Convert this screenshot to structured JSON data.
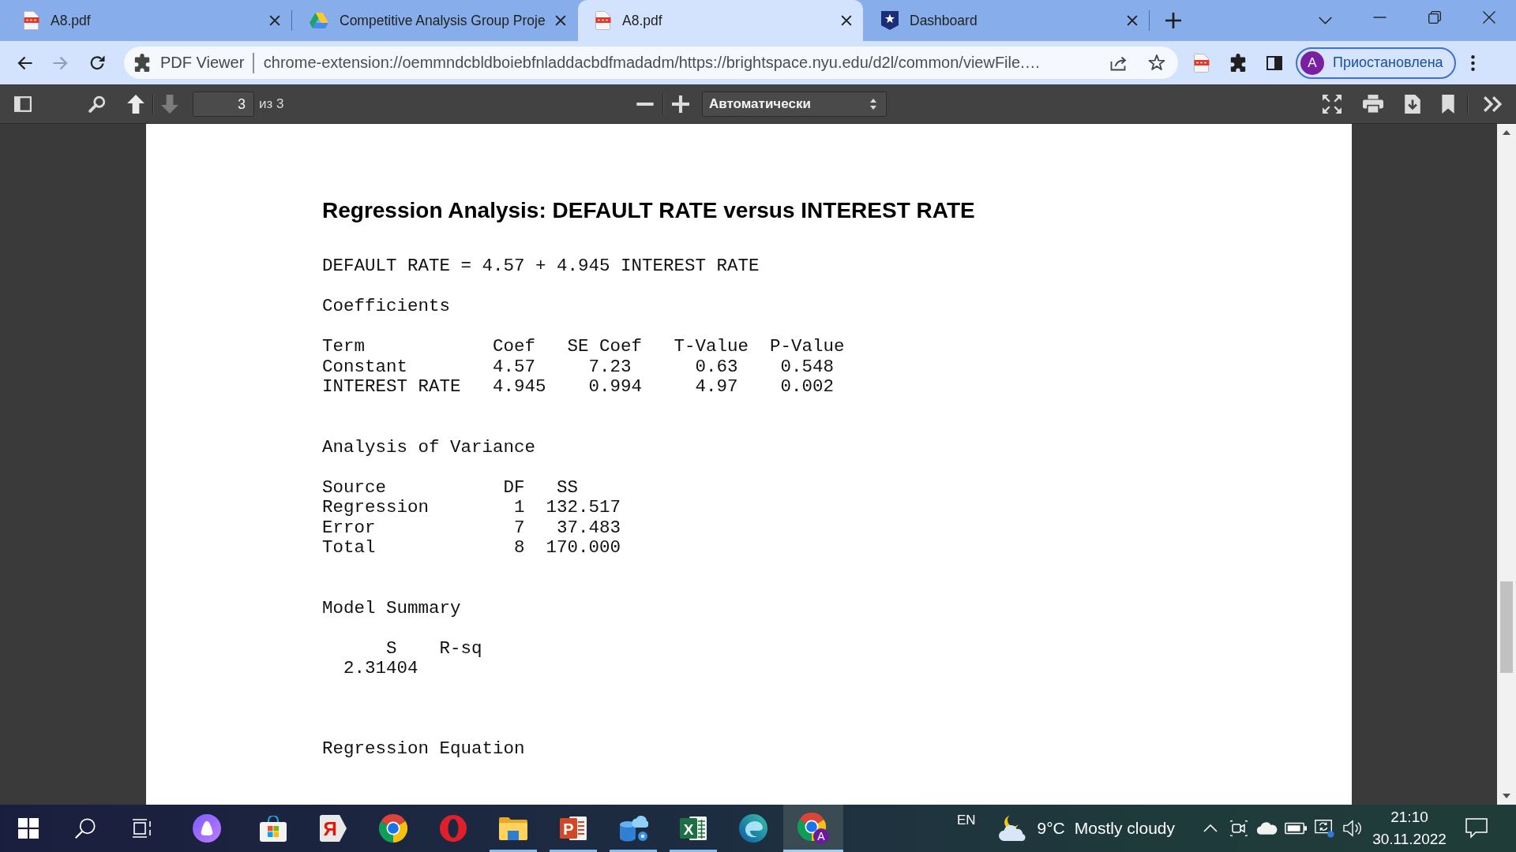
{
  "browser": {
    "tabs": [
      {
        "kind": "pdf",
        "title": "A8.pdf",
        "selected": false
      },
      {
        "kind": "drive",
        "title": "Competitive Analysis Group Proje",
        "selected": false
      },
      {
        "kind": "pdf",
        "title": "A8.pdf",
        "selected": true
      },
      {
        "kind": "dashboard",
        "title": "Dashboard",
        "selected": false
      }
    ],
    "address_bar": {
      "chip": "PDF Viewer",
      "url": "chrome-extension://oemmndcbldboiebfnladdacbdfmadadm/https://brightspace.nyu.edu/d2l/common/viewFile.…"
    },
    "profile": {
      "initial": "A",
      "status": "Приостановлена"
    }
  },
  "pdf_toolbar": {
    "previous": {
      "disabled": false
    },
    "next": {
      "disabled": true
    },
    "page": "3",
    "page_count": "из 3",
    "zoom": "Автоматически"
  },
  "document": {
    "title": "Regression Analysis: DEFAULT RATE versus INTEREST RATE",
    "equation": "DEFAULT RATE = 4.57 + 4.945 INTEREST RATE",
    "sections": [
      {
        "heading": "Coefficients",
        "columns": [
          "Term",
          "Coef",
          "SE Coef",
          "T-Value",
          "P-Value"
        ],
        "rows": [
          [
            "Constant",
            "4.57",
            "7.23",
            "0.63",
            "0.548"
          ],
          [
            "INTEREST RATE",
            "4.945",
            "0.994",
            "4.97",
            "0.002"
          ]
        ]
      },
      {
        "heading": "Analysis of Variance",
        "columns": [
          "Source",
          "DF",
          "SS"
        ],
        "rows": [
          [
            "Regression",
            "1",
            "132.517"
          ],
          [
            "Error",
            "7",
            "37.483"
          ],
          [
            "Total",
            "8",
            "170.000"
          ]
        ]
      },
      {
        "heading": "Model Summary",
        "columns": [
          "S",
          "R-sq"
        ],
        "rows": [
          [
            "2.31404"
          ]
        ]
      },
      {
        "heading": "Regression Equation"
      }
    ]
  },
  "taskbar": {
    "buttons": [
      {
        "kind": "start"
      },
      {
        "kind": "search"
      },
      {
        "kind": "task_view"
      }
    ],
    "apps": [
      {
        "kind": "orb",
        "running": false,
        "active": false
      },
      {
        "kind": "bag",
        "running": false,
        "active": false
      },
      {
        "kind": "letter_arrow",
        "letter": "Я",
        "running": false,
        "active": false
      },
      {
        "kind": "segmented_circle",
        "running": false,
        "active": false
      },
      {
        "kind": "ring",
        "running": false,
        "active": false
      },
      {
        "kind": "folder",
        "running": true,
        "active": false
      },
      {
        "kind": "slides",
        "letter": "P",
        "running": true,
        "active": false
      },
      {
        "kind": "database",
        "running": true,
        "active": false
      },
      {
        "kind": "sheet",
        "letter": "X",
        "running": true,
        "active": false
      },
      {
        "kind": "swirl",
        "running": false,
        "active": false
      },
      {
        "kind": "segmented_circle_badge",
        "letter": "A",
        "running": true,
        "active": true
      }
    ],
    "language": "EN",
    "weather": {
      "temperature": "9°C",
      "condition": "Mostly cloudy"
    },
    "time": "21:10",
    "date": "30.11.2022"
  }
}
